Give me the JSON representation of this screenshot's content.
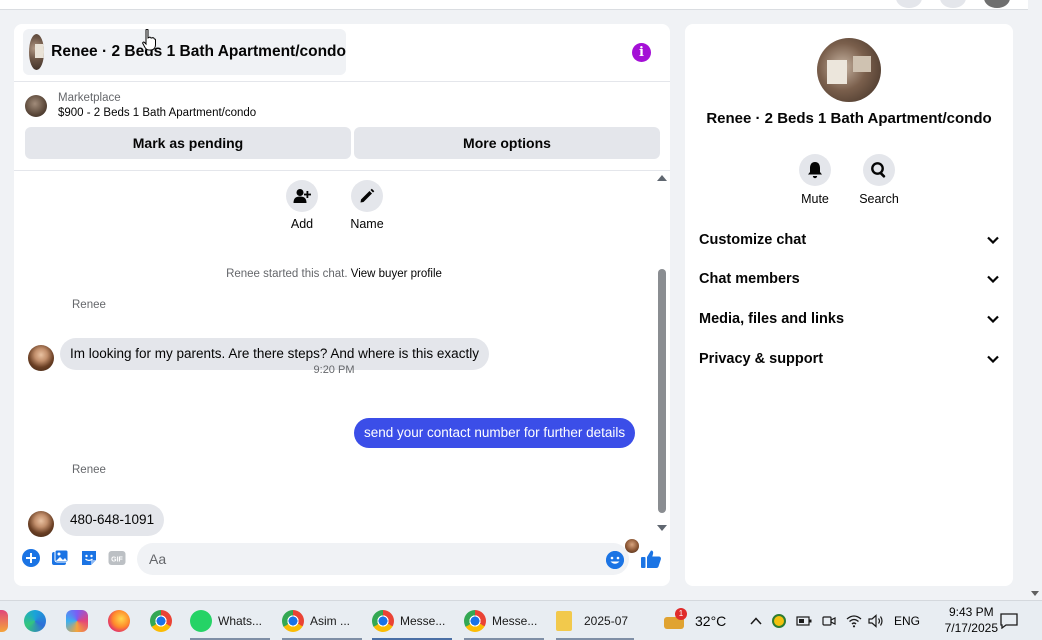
{
  "chat": {
    "title": "Renee · 2 Beds 1 Bath Apartment/condo",
    "listing": {
      "category": "Marketplace",
      "price_title": "$900 - 2 Beds 1 Bath Apartment/condo"
    },
    "buttons": {
      "pending": "Mark as pending",
      "more": "More options"
    },
    "actions": {
      "add": "Add",
      "name": "Name"
    },
    "started_text": "Renee started this chat.",
    "view_profile": "View buyer profile",
    "messages": [
      {
        "sender": "Renee",
        "text": "Im looking for my parents. Are there steps?  And where is this exactly"
      },
      {
        "time": "9:20 PM"
      },
      {
        "text": "send your contact number for further details"
      },
      {
        "sender": "Renee",
        "text": "480-648-1091"
      }
    ],
    "composer_placeholder": "Aa"
  },
  "info": {
    "name": "Renee · 2 Beds 1 Bath Apartment/condo",
    "mute": "Mute",
    "search": "Search",
    "sections": [
      "Customize chat",
      "Chat members",
      "Media, files and links",
      "Privacy & support"
    ]
  },
  "taskbar": {
    "apps": [
      {
        "icon": "copilot-icon",
        "label": ""
      },
      {
        "icon": "edge-icon",
        "label": ""
      },
      {
        "icon": "copilot-app-icon",
        "label": ""
      },
      {
        "icon": "firefox-icon",
        "label": ""
      },
      {
        "icon": "chrome-icon",
        "label": ""
      },
      {
        "icon": "whatsapp-icon",
        "label": "Whats..."
      },
      {
        "icon": "chrome-profile-icon",
        "label": "Asim ..."
      },
      {
        "icon": "chrome-messenger-icon",
        "label": "Messe..."
      },
      {
        "icon": "chrome-messenger-icon-2",
        "label": "Messe..."
      },
      {
        "icon": "folder-icon",
        "label": "2025-07"
      }
    ],
    "weather_badge": "1",
    "temperature": "32°C",
    "language": "ENG",
    "time": "9:43 PM",
    "date": "7/17/2025"
  },
  "colors": {
    "accent": "#0866ff",
    "outgoing_bubble": "#3b4ee8",
    "info_icon": "#a40fd6"
  }
}
